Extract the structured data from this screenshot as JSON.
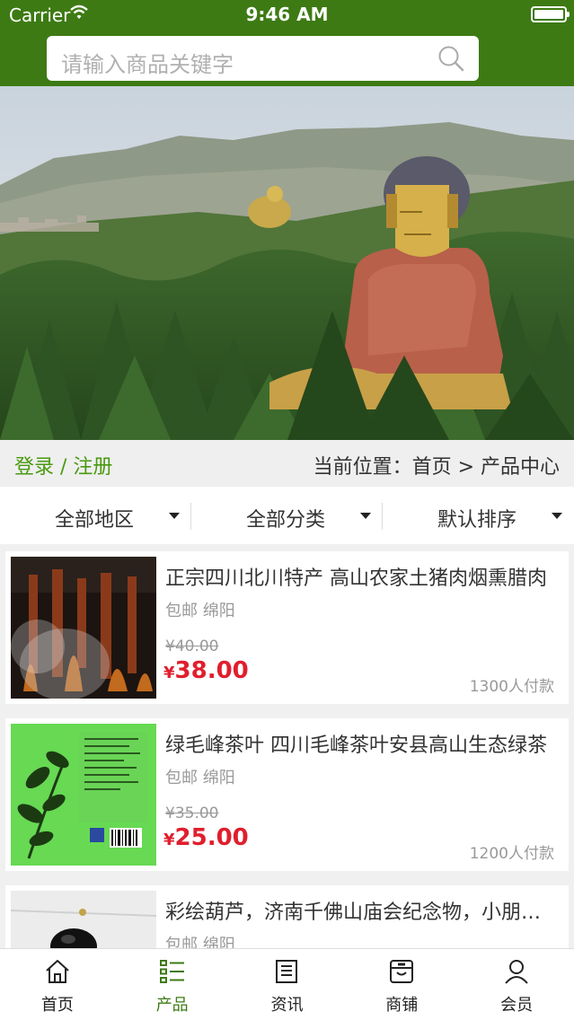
{
  "status_bar": {
    "carrier": "Carrier",
    "time": "9:46 AM"
  },
  "search": {
    "placeholder": "请输入商品关键字"
  },
  "breadcrumb": {
    "login": "登录 / 注册",
    "location": "当前位置：首页 > 产品中心"
  },
  "filters": [
    {
      "label": "全部地区"
    },
    {
      "label": "全部分类"
    },
    {
      "label": "默认排序"
    }
  ],
  "products": [
    {
      "title": "正宗四川北川特产 高山农家土猪肉烟熏腊肉",
      "tags": "包邮 绵阳",
      "old_price": "¥40.00",
      "currency": "¥",
      "price": "38.00",
      "paid": "1300人付款"
    },
    {
      "title": "绿毛峰茶叶 四川毛峰茶叶安县高山生态绿茶",
      "tags": "包邮 绵阳",
      "old_price": "¥35.00",
      "currency": "¥",
      "price": "25.00",
      "paid": "1200人付款"
    },
    {
      "title": "彩绘葫芦，济南千佛山庙会纪念物，小朋友喜欢",
      "tags": "包邮 绵阳",
      "old_price": "",
      "currency": "",
      "price": "",
      "paid": ""
    }
  ],
  "tabs": [
    {
      "label": "首页",
      "icon": "home-icon"
    },
    {
      "label": "产品",
      "icon": "list-icon"
    },
    {
      "label": "资讯",
      "icon": "news-icon"
    },
    {
      "label": "商铺",
      "icon": "store-icon"
    },
    {
      "label": "会员",
      "icon": "user-icon"
    }
  ],
  "colors": {
    "header": "#3d7a14",
    "accent_green": "#4a9a10",
    "price_red": "#e01e2e"
  }
}
